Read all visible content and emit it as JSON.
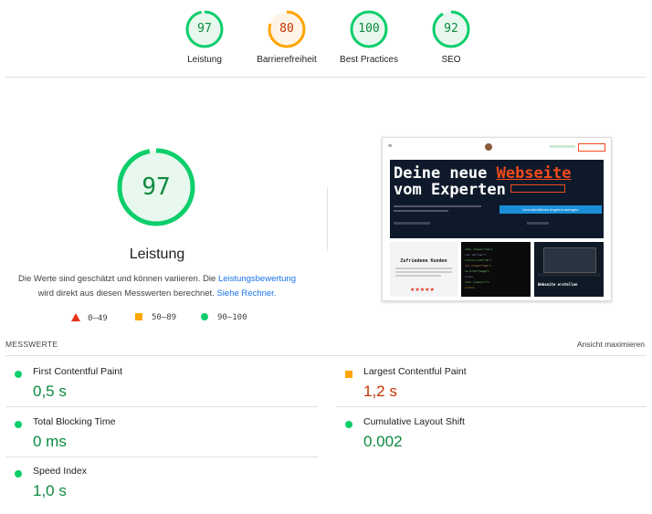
{
  "top_gauges": [
    {
      "score": "97",
      "label": "Leistung",
      "color": "#0cce6b",
      "text_color": "#0c8a3e",
      "bg": "#e8f8ee",
      "fraction": 0.97
    },
    {
      "score": "80",
      "label": "Barrierefreiheit",
      "color": "#ffa400",
      "text_color": "#c33300",
      "bg": "#fff4e5",
      "fraction": 0.8
    },
    {
      "score": "100",
      "label": "Best Practices",
      "color": "#0cce6b",
      "text_color": "#0c8a3e",
      "bg": "#e8f8ee",
      "fraction": 1.0
    },
    {
      "score": "92",
      "label": "SEO",
      "color": "#0cce6b",
      "text_color": "#0c8a3e",
      "bg": "#e8f8ee",
      "fraction": 0.92
    }
  ],
  "performance": {
    "score": "97",
    "fraction": 0.97,
    "title": "Leistung",
    "desc_part1": "Die Werte sind geschätzt und können variieren. Die ",
    "desc_link1": "Leistungsbewertung",
    "desc_part2": " wird direkt aus diesen Messwerten berechnet. ",
    "desc_link2": "Siehe Rechner."
  },
  "legend": {
    "fail": "0–49",
    "average": "50–89",
    "pass": "90–100"
  },
  "screenshot_preview": {
    "headline_line1_a": "Deine neue ",
    "headline_accent": "Webseite",
    "headline_line2": "vom Experten",
    "cta": "Unverbindliches Angebot anfragen",
    "card1_title": "Zufriedene Kunden",
    "card1_stars": "★★★★★",
    "card3_title": "Webseite erstellen"
  },
  "metrics_header": {
    "title": "MESSWERTE",
    "expand": "Ansicht maximieren"
  },
  "metrics": [
    {
      "name": "First Contentful Paint",
      "value": "0,5 s",
      "status": "pass",
      "color": "#0c8a3e"
    },
    {
      "name": "Largest Contentful Paint",
      "value": "1,2 s",
      "status": "average",
      "color": "#c33300"
    },
    {
      "name": "Total Blocking Time",
      "value": "0 ms",
      "status": "pass",
      "color": "#0c8a3e"
    },
    {
      "name": "Cumulative Layout Shift",
      "value": "0.002",
      "status": "pass",
      "color": "#0c8a3e"
    },
    {
      "name": "Speed Index",
      "value": "1,0 s",
      "status": "pass",
      "color": "#0c8a3e"
    }
  ]
}
